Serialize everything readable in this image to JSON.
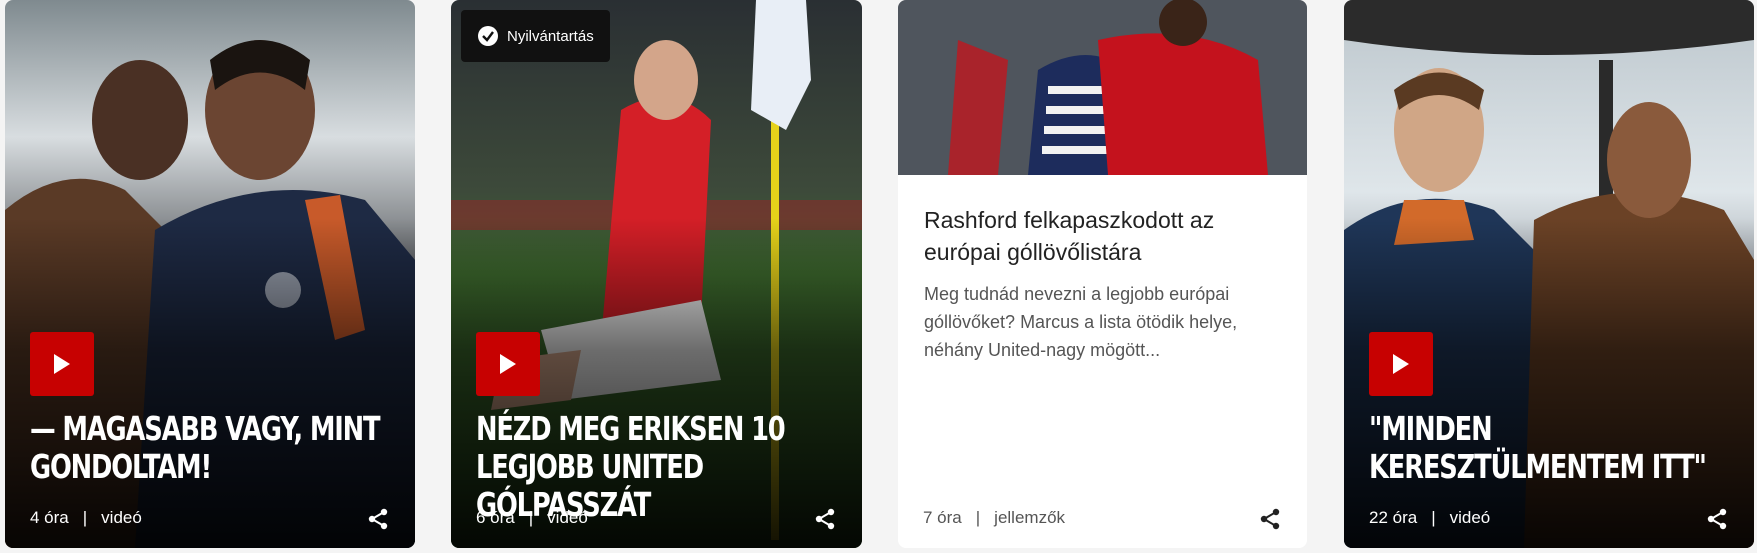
{
  "cards": [
    {
      "title": "— MAGASABB VAGY, MINT GONDOLTAM!",
      "time": "4 óra",
      "category": "videó",
      "type": "video"
    },
    {
      "badge": "Nyilvántartás",
      "title": "NÉZD MEG ERIKSEN 10 LEGJOBB UNITED GÓLPASSZÁT",
      "time": "6 óra",
      "category": "videó",
      "type": "video"
    },
    {
      "title": "Rashford felkapaszkodott az európai góllövőlistára",
      "description": "Meg tudnád nevezni a legjobb európai góllövőket? Marcus a lista ötödik helye, néhány United-nagy mögött...",
      "time": "7 óra",
      "category": "jellemzők",
      "type": "article"
    },
    {
      "title": "\"MINDEN KERESZTÜLMENTEM ITT\"",
      "time": "22 óra",
      "category": "videó",
      "type": "video"
    }
  ],
  "separator": "|",
  "icons": {
    "play": "play-icon",
    "share": "share-icon",
    "badge": "check-circle-icon"
  },
  "colors": {
    "accent": "#c70101",
    "badge_bg": "#111111"
  }
}
